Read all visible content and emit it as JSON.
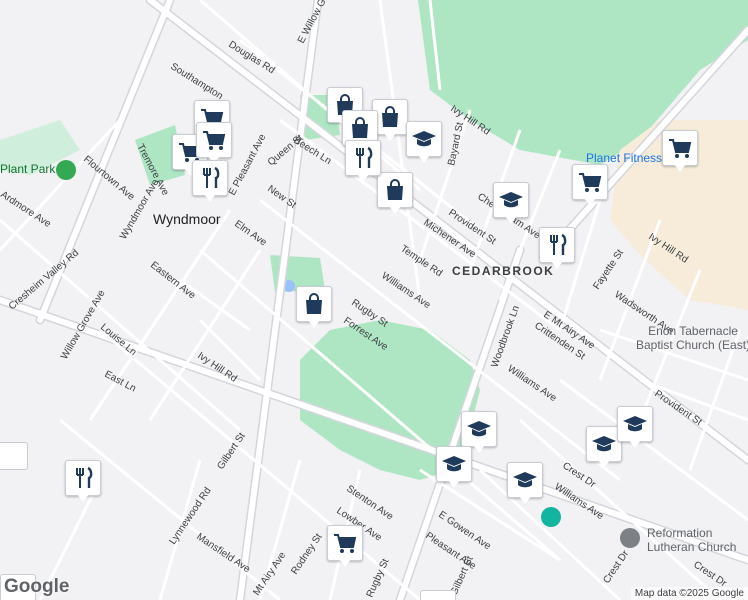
{
  "map": {
    "neighborhoods": [
      "Wyndmoor",
      "CEDARBROOK"
    ],
    "places": [
      {
        "name": "Plant Park",
        "type": "park"
      },
      {
        "name": "Planet Fitness",
        "type": "gym"
      },
      {
        "name": "Enon Tabernacle Baptist Church (East)",
        "line1": "Enon Tabernacle",
        "line2": "Baptist Church (East)",
        "type": "church"
      },
      {
        "name": "Reformation Lutheran Church",
        "line1": "Reformation",
        "line2": "Lutheran Church",
        "type": "church"
      }
    ],
    "streets": [
      "Douglas Rd",
      "E Willow Grove Ave",
      "Southampton",
      "Tremore Ave",
      "Flourtown Ave",
      "Ardmore Ave",
      "E Pleasant Ave",
      "Queen St",
      "Beech Ln",
      "New St",
      "Elm Ave",
      "Wyndmoor Ave",
      "Cresheim Valley Rd",
      "Eastern Ave",
      "Willow Grove Ave",
      "Pine Rd",
      "Louise Ln",
      "East Ln",
      "Ivy Hill Rd",
      "Gilbert St",
      "Rugby St",
      "Forrest Ave",
      "Williams Ave",
      "Temple Rd",
      "Michener Ave",
      "Provident St",
      "Cheltenham Ave",
      "Ivy Hill Rd",
      "Bayard St",
      "E Mt Airy Ave",
      "Wadsworth Ave",
      "Fayette St",
      "Woodbrook Ln",
      "Crittenden St",
      "Lynnewood Rd",
      "Mansfield Ave",
      "Stenton Ave",
      "Lowber Ave",
      "Rodney St",
      "E Gowen Ave",
      "Pleasant Ave",
      "Mt Airy Ave",
      "Gilbert St",
      "Rugby St",
      "Crest Dr",
      "Williams Ave"
    ],
    "poi_pins": [
      {
        "icon": "shopping-bag-icon"
      },
      {
        "icon": "shopping-bag-icon"
      },
      {
        "icon": "shopping-bag-icon"
      },
      {
        "icon": "shopping-bag-icon"
      },
      {
        "icon": "shopping-bag-icon"
      },
      {
        "icon": "shopping-cart-icon"
      },
      {
        "icon": "shopping-cart-icon"
      },
      {
        "icon": "shopping-cart-icon"
      },
      {
        "icon": "shopping-cart-icon"
      },
      {
        "icon": "shopping-cart-icon"
      },
      {
        "icon": "shopping-cart-icon"
      },
      {
        "icon": "restaurant-icon"
      },
      {
        "icon": "restaurant-icon"
      },
      {
        "icon": "restaurant-icon"
      },
      {
        "icon": "restaurant-icon"
      },
      {
        "icon": "school-icon"
      },
      {
        "icon": "school-icon"
      },
      {
        "icon": "school-icon"
      },
      {
        "icon": "school-icon"
      },
      {
        "icon": "school-icon"
      },
      {
        "icon": "school-icon"
      },
      {
        "icon": "school-icon"
      }
    ],
    "attribution": "Map data ©2025 Google",
    "logo": "Google"
  },
  "colors": {
    "background": "#f2f1f4",
    "park": "#aee6c4",
    "commercial": "#f6ecd9",
    "road": "#ffffff",
    "road_outline": "#d4d6dc",
    "highway": "#c9ced6",
    "pin_icon": "#1f3a5a"
  }
}
